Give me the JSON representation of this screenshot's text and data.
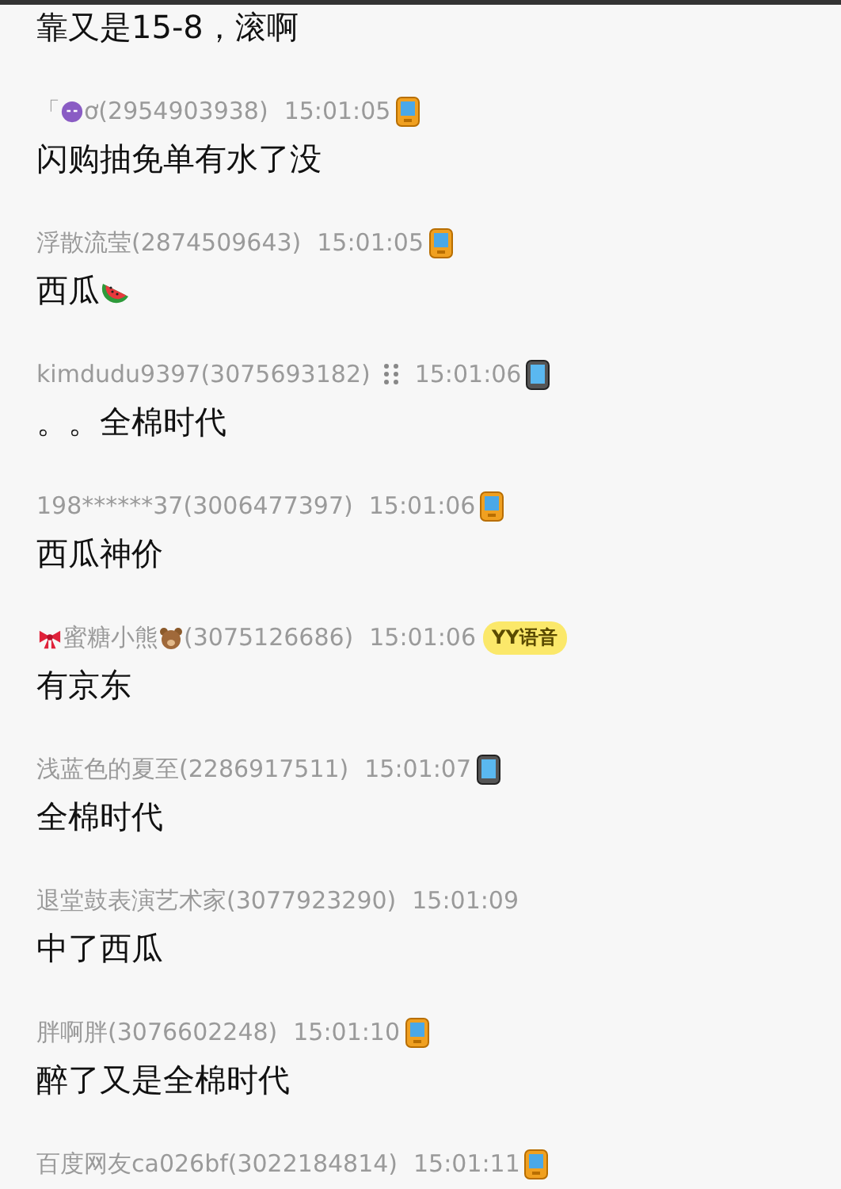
{
  "messages": [
    {
      "message": [
        {
          "kind": "text",
          "text": "靠又是15-8，滚啊"
        }
      ]
    },
    {
      "sender": [
        {
          "kind": "text",
          "text": "「"
        },
        {
          "kind": "smiley"
        },
        {
          "kind": "text",
          "text": "ơ(2954903938)"
        }
      ],
      "time": "15:01:05",
      "device": {
        "kind": "phone"
      },
      "message": [
        {
          "kind": "text",
          "text": "闪购抽免单有水了没"
        }
      ]
    },
    {
      "sender": [
        {
          "kind": "text",
          "text": "浮散流莹(2874509643)"
        }
      ],
      "time": "15:01:05",
      "device": {
        "kind": "phone"
      },
      "message": [
        {
          "kind": "text",
          "text": "西瓜"
        },
        {
          "kind": "watermelon"
        }
      ]
    },
    {
      "sender": [
        {
          "kind": "text",
          "text": "kimdudu9397(3075693182)"
        },
        {
          "kind": "dots"
        }
      ],
      "time": "15:01:06",
      "device": {
        "kind": "tablet"
      },
      "message": [
        {
          "kind": "text",
          "text": "。。全棉时代"
        }
      ]
    },
    {
      "sender": [
        {
          "kind": "text",
          "text": "198******37(3006477397)"
        }
      ],
      "time": "15:01:06",
      "device": {
        "kind": "phone"
      },
      "message": [
        {
          "kind": "text",
          "text": "西瓜神价"
        }
      ]
    },
    {
      "sender": [
        {
          "kind": "bow"
        },
        {
          "kind": "text",
          "text": "蜜糖小熊"
        },
        {
          "kind": "bear"
        },
        {
          "kind": "text",
          "text": "(3075126686)"
        }
      ],
      "time": "15:01:06",
      "device": {
        "kind": "badge",
        "text": "YY语音"
      },
      "message": [
        {
          "kind": "text",
          "text": "有京东"
        }
      ]
    },
    {
      "sender": [
        {
          "kind": "text",
          "text": "浅蓝色的夏至(2286917511)"
        }
      ],
      "time": "15:01:07",
      "device": {
        "kind": "tablet"
      },
      "message": [
        {
          "kind": "text",
          "text": "全棉时代"
        }
      ]
    },
    {
      "sender": [
        {
          "kind": "text",
          "text": "退堂鼓表演艺术家(3077923290)"
        }
      ],
      "time": "15:01:09",
      "message": [
        {
          "kind": "text",
          "text": "中了西瓜"
        }
      ]
    },
    {
      "sender": [
        {
          "kind": "text",
          "text": "胖啊胖(3076602248)"
        }
      ],
      "time": "15:01:10",
      "device": {
        "kind": "phone"
      },
      "message": [
        {
          "kind": "text",
          "text": "醉了又是全棉时代"
        }
      ]
    },
    {
      "sender": [
        {
          "kind": "text",
          "text": "百度网友ca026bf(3022184814)"
        }
      ],
      "time": "15:01:11",
      "device": {
        "kind": "phone"
      }
    }
  ]
}
